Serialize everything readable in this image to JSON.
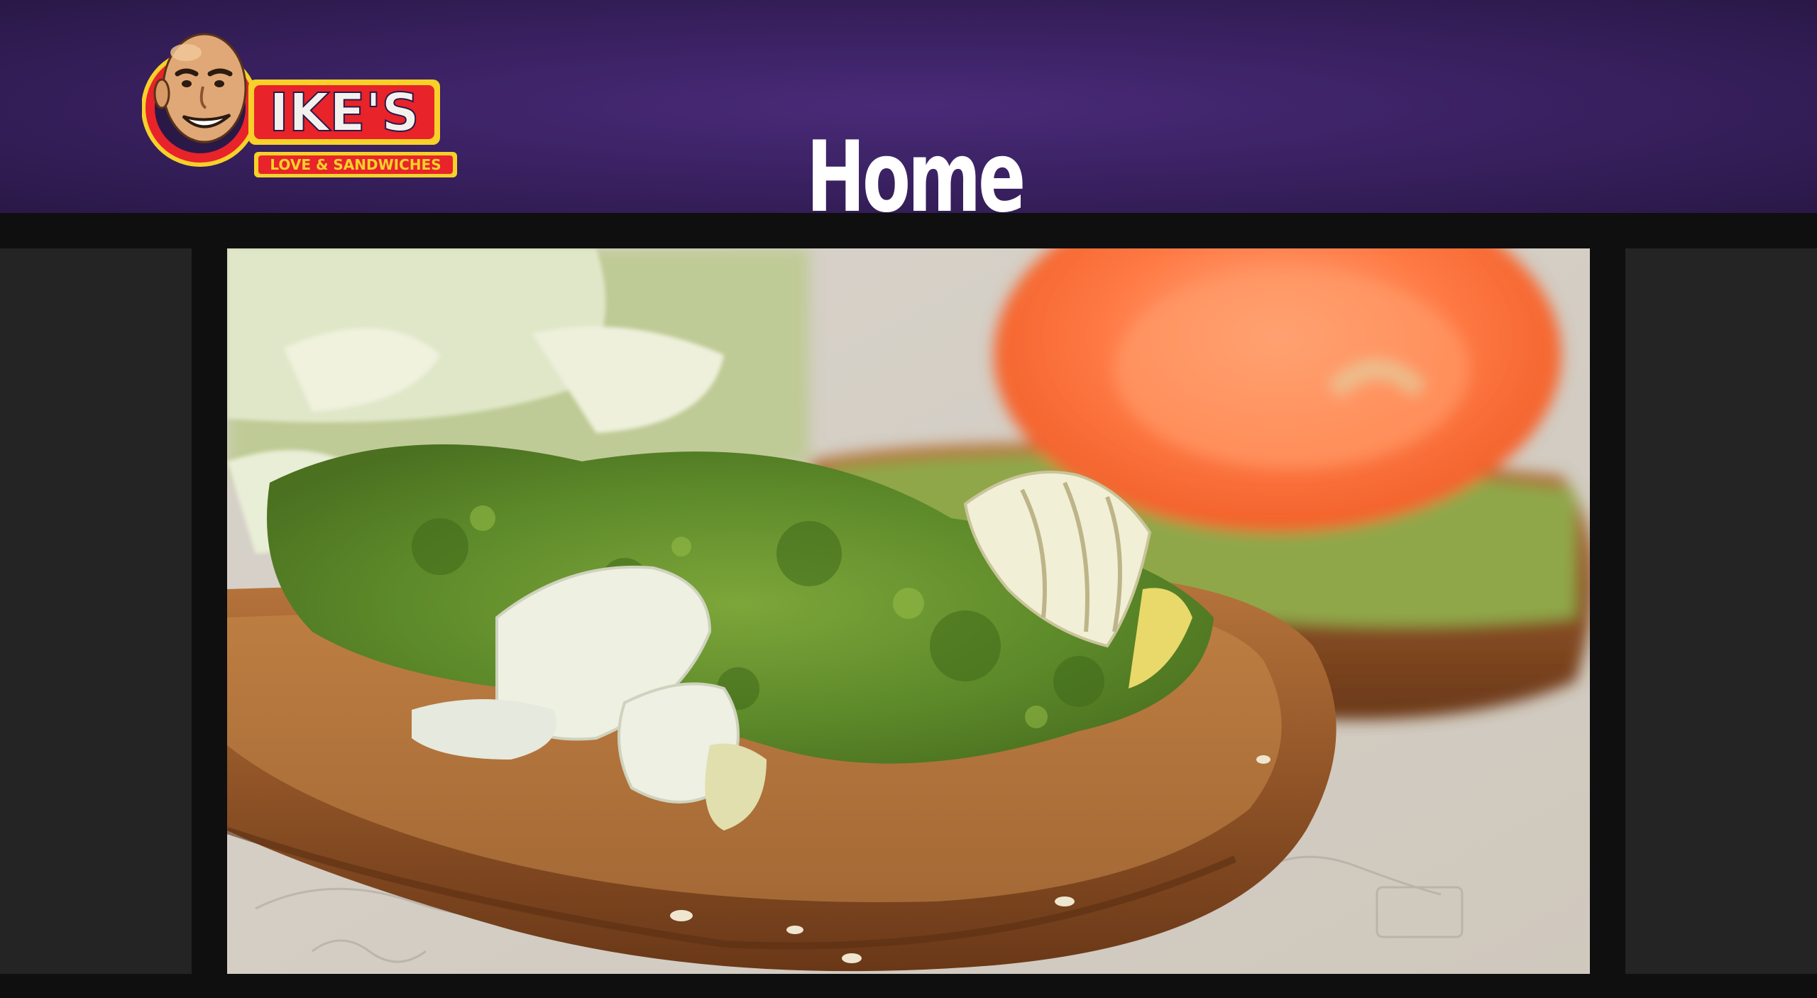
{
  "header": {
    "title": "Home",
    "background_color": "#3b2264"
  },
  "logo": {
    "brand_name": "IKE'S",
    "tagline": "LOVE & SANDWICHES",
    "icon": "mascot-face-icon"
  },
  "hero_image": {
    "icon": "sandwich-photo",
    "subject": "toasted bread with pesto, artichoke hearts and tomato"
  },
  "colors": {
    "side_panel": "#242424",
    "frame": "#0f0f10",
    "logo_red": "#e8232a",
    "logo_yellow": "#f7d12a"
  }
}
